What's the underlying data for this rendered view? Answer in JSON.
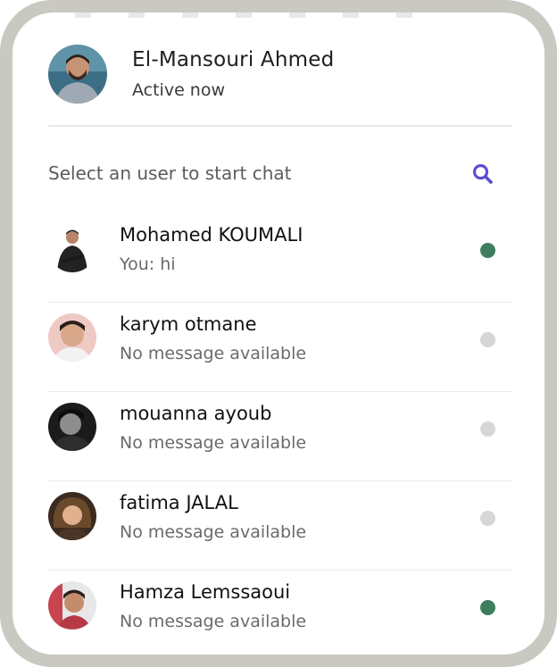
{
  "colors": {
    "frame": "#c9c9c1",
    "accent": "#5a4fcf",
    "online": "#3f7d5f",
    "offline": "#d6d6d6"
  },
  "header": {
    "name": "El-Mansouri Ahmed",
    "status": "Active now",
    "avatar_icon": "user-photo-avatar"
  },
  "search": {
    "label": "Select an user to start chat",
    "icon": "search-icon"
  },
  "users": [
    {
      "name": "Mohamed KOUMALI",
      "message": "You: hi",
      "online": true
    },
    {
      "name": "karym otmane",
      "message": "No message available",
      "online": false
    },
    {
      "name": "mouanna ayoub",
      "message": "No message available",
      "online": false
    },
    {
      "name": "fatima JALAL",
      "message": "No message available",
      "online": false
    },
    {
      "name": "Hamza Lemssaoui",
      "message": "No message available",
      "online": true
    }
  ]
}
